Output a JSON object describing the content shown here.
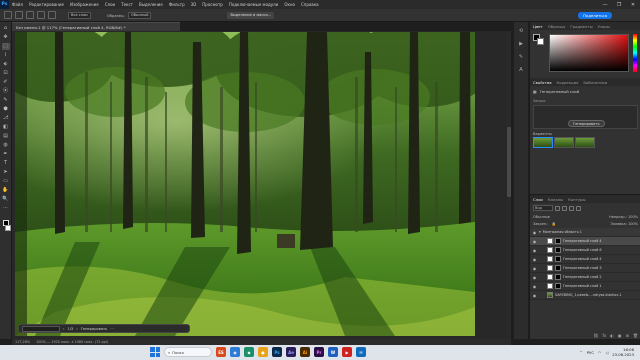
{
  "menubar": {
    "logo": "Ps",
    "items": [
      "Файл",
      "Редактирование",
      "Изображение",
      "Слои",
      "Текст",
      "Выделение",
      "Фильтр",
      "3D",
      "Просмотр",
      "Подключаемые модули",
      "Окно",
      "Справка"
    ],
    "controls": [
      "—",
      "❐",
      "✕"
    ]
  },
  "options": {
    "sample_label": "Все слои",
    "mode_label": "Образец:",
    "mode_value": "Обычный",
    "select_subject": "Выделение и маска...",
    "share": "Поделиться"
  },
  "tools": [
    "⌂",
    "✥",
    "⬚",
    "⌇",
    "⬖",
    "⊡",
    "✐",
    "⦿",
    "✎",
    "⬢",
    "⎇",
    "◧",
    "▤",
    "◍",
    "✒",
    "T",
    "➤",
    "▭",
    "✋",
    "🔍",
    "⋯"
  ],
  "document": {
    "tab_title": "Без имени-1 @ 117% (Генеративный слой 4, RGB/8#) *",
    "status": "100% — 1920 пикс. x 1080 пикс. (72 ppi)",
    "zoom": "117,28%"
  },
  "context_bar": {
    "counter": "1/3",
    "generate": "Генерировать"
  },
  "panels": {
    "color_tabs": [
      "Цвет",
      "Образцы",
      "Градиенты",
      "Узоры"
    ],
    "props_tabs": [
      "Свойства",
      "Коррекция",
      "Библиотеки"
    ],
    "props_layer": "Генеративный слой",
    "props_prompt_label": "Запрос",
    "props_generate": "Генерировать",
    "variants_label": "Варианты",
    "layers_tabs": [
      "Слои",
      "Каналы",
      "Контуры"
    ],
    "layer_filter": "Вид",
    "blend_mode": "Обычные",
    "opacity": "Непрозр.: 100%",
    "lock": "Закреп.:",
    "fill": "Заливка: 100%",
    "layers": [
      {
        "name": "Монтажная область 1",
        "type": "group"
      },
      {
        "name": "Генеративный слой 4",
        "type": "layer",
        "selected": true
      },
      {
        "name": "Генеративный слой 6",
        "type": "layer"
      },
      {
        "name": "Генеративный слой 4",
        "type": "layer"
      },
      {
        "name": "Генеративный слой 3",
        "type": "layer"
      },
      {
        "name": "Генеративный слой 2",
        "type": "layer"
      },
      {
        "name": "Генеративный слой 1",
        "type": "layer"
      },
      {
        "name": "SAFEBIMG_1.pexels-...ndrysa-kiseliov-1",
        "type": "image"
      }
    ],
    "layers_footer": [
      "fx",
      "◐",
      "▣",
      "⊞",
      "🗑"
    ]
  },
  "taskbar": {
    "search_placeholder": "Поиск",
    "apps": [
      {
        "label": "ES",
        "color": "#d64a1e"
      },
      {
        "label": "◉",
        "color": "#2d7cd6"
      },
      {
        "label": "◆",
        "color": "#1b8f6a"
      },
      {
        "label": "●",
        "color": "#e8a21a"
      },
      {
        "label": "Ps",
        "color": "#0b2a4a"
      },
      {
        "label": "Ae",
        "color": "#2a1e58"
      },
      {
        "label": "Ai",
        "color": "#4a2a00"
      },
      {
        "label": "Pr",
        "color": "#2a0f45"
      },
      {
        "label": "W",
        "color": "#1f5fbf"
      },
      {
        "label": "▶",
        "color": "#cc2222"
      },
      {
        "label": "✉",
        "color": "#0f6cbd"
      }
    ],
    "lang": "РУС",
    "time": "16:06",
    "date": "23.06.2023"
  }
}
